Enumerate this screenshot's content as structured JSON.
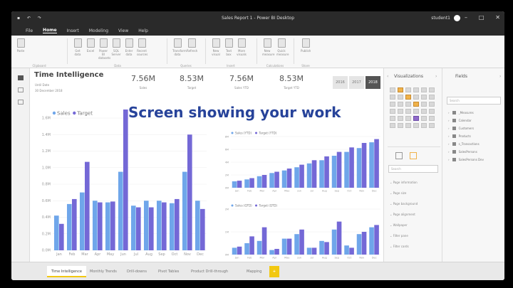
{
  "window": {
    "title": "Sales Report 1 - Power BI Desktop",
    "user": "student1"
  },
  "menu": [
    "File",
    "Home",
    "Insert",
    "Modeling",
    "View",
    "Help"
  ],
  "ribbon": {
    "groups": [
      "Clipboard",
      "Data",
      "Queries",
      "Insert",
      "Calculations",
      "Share"
    ],
    "buttons": [
      "Paste",
      "Get data",
      "Excel",
      "Power BI datasets",
      "SQL Server",
      "Enter data",
      "Recent sources",
      "Transform data",
      "Refresh",
      "New visual",
      "Text box",
      "More visuals",
      "New measure",
      "Quick measure",
      "Publish"
    ]
  },
  "report": {
    "title": "Time Intelligence",
    "subtitle1": "Until Date",
    "subtitle2": "30 December 2018",
    "kpis": [
      {
        "value": "7.56M",
        "label": "Sales"
      },
      {
        "value": "8.53M",
        "label": "Target"
      },
      {
        "value": "7.56M",
        "label": "Sales YTD"
      },
      {
        "value": "8.53M",
        "label": "Target YTD"
      }
    ],
    "years": [
      "2016",
      "2017",
      "2018"
    ],
    "selected_year": "2018"
  },
  "overlay_text": "Screen showing your work",
  "colors": {
    "sales": "#6fa6ea",
    "target": "#7468d6",
    "accent": "#f2c811",
    "overlay": "#27439a"
  },
  "chart_data": [
    {
      "type": "bar",
      "title": "",
      "categories": [
        "Jan",
        "Feb",
        "Mar",
        "Apr",
        "May",
        "Jun",
        "Jul",
        "Aug",
        "Sep",
        "Oct",
        "Nov",
        "Dec"
      ],
      "series": [
        {
          "name": "Sales",
          "values": [
            0.42,
            0.56,
            0.7,
            0.6,
            0.58,
            0.95,
            0.54,
            0.6,
            0.6,
            0.57,
            0.95,
            0.6
          ]
        },
        {
          "name": "Target",
          "values": [
            0.32,
            0.62,
            1.07,
            0.58,
            0.59,
            1.72,
            0.52,
            0.52,
            0.58,
            0.62,
            1.4,
            0.5
          ]
        }
      ],
      "yticks": [
        "0.0M",
        "0.2M",
        "0.4M",
        "0.6M",
        "0.8M",
        "1.0M",
        "1.2M",
        "1.4M",
        "1.6M"
      ],
      "ylim": [
        0,
        1.6
      ]
    },
    {
      "type": "bar",
      "title": "",
      "categories": [
        "Jan",
        "Feb",
        "Mar",
        "Apr",
        "May",
        "Jun",
        "Jul",
        "Aug",
        "Sep",
        "Oct",
        "Nov",
        "Dec"
      ],
      "series": [
        {
          "name": "Sales (YTD)",
          "values": [
            1.0,
            1.3,
            1.8,
            2.3,
            2.7,
            3.2,
            3.8,
            4.3,
            5.0,
            5.6,
            6.2,
            7.1
          ]
        },
        {
          "name": "Target (YTD)",
          "values": [
            1.1,
            1.5,
            2.0,
            2.5,
            3.0,
            3.6,
            4.3,
            4.9,
            5.6,
            6.3,
            7.0,
            7.6
          ]
        }
      ],
      "yticks": [
        "0M",
        "2M",
        "4M",
        "6M",
        "8M"
      ],
      "ylim": [
        0,
        8
      ]
    },
    {
      "type": "bar",
      "title": "",
      "categories": [
        "Jan",
        "Feb",
        "Mar",
        "Apr",
        "May",
        "Jun",
        "Jul",
        "Aug",
        "Sep",
        "Oct",
        "Nov",
        "Dec"
      ],
      "series": [
        {
          "name": "Sales (QTD)",
          "values": [
            0.3,
            0.5,
            0.6,
            0.2,
            0.7,
            0.9,
            0.3,
            0.6,
            1.1,
            0.4,
            0.9,
            1.2
          ]
        },
        {
          "name": "Target (QTD)",
          "values": [
            0.35,
            0.8,
            1.2,
            0.25,
            0.7,
            1.1,
            0.3,
            0.55,
            1.45,
            0.3,
            1.0,
            1.3
          ]
        }
      ],
      "yticks": [
        "0M",
        "1M",
        "2M"
      ],
      "ylim": [
        0,
        2
      ]
    }
  ],
  "visualizations": {
    "title": "Visualizations",
    "search_placeholder": "Search",
    "sections": [
      "Page information",
      "Page size",
      "Page background",
      "Page alignment",
      "Wallpaper",
      "Filter pane",
      "Filter cards"
    ]
  },
  "fields": {
    "title": "Fields",
    "search_placeholder": "Search",
    "items": [
      "_Measures",
      "Calendar",
      "Customers",
      "Products",
      "s_Transactions",
      "SalesPersons",
      "SalesPersons Dev"
    ]
  },
  "pages": [
    "Time Intelligence",
    "Monthly Trends",
    "Drill-downs",
    "Pivot Tables",
    "Product Drill-through",
    "Mapping",
    "+"
  ]
}
